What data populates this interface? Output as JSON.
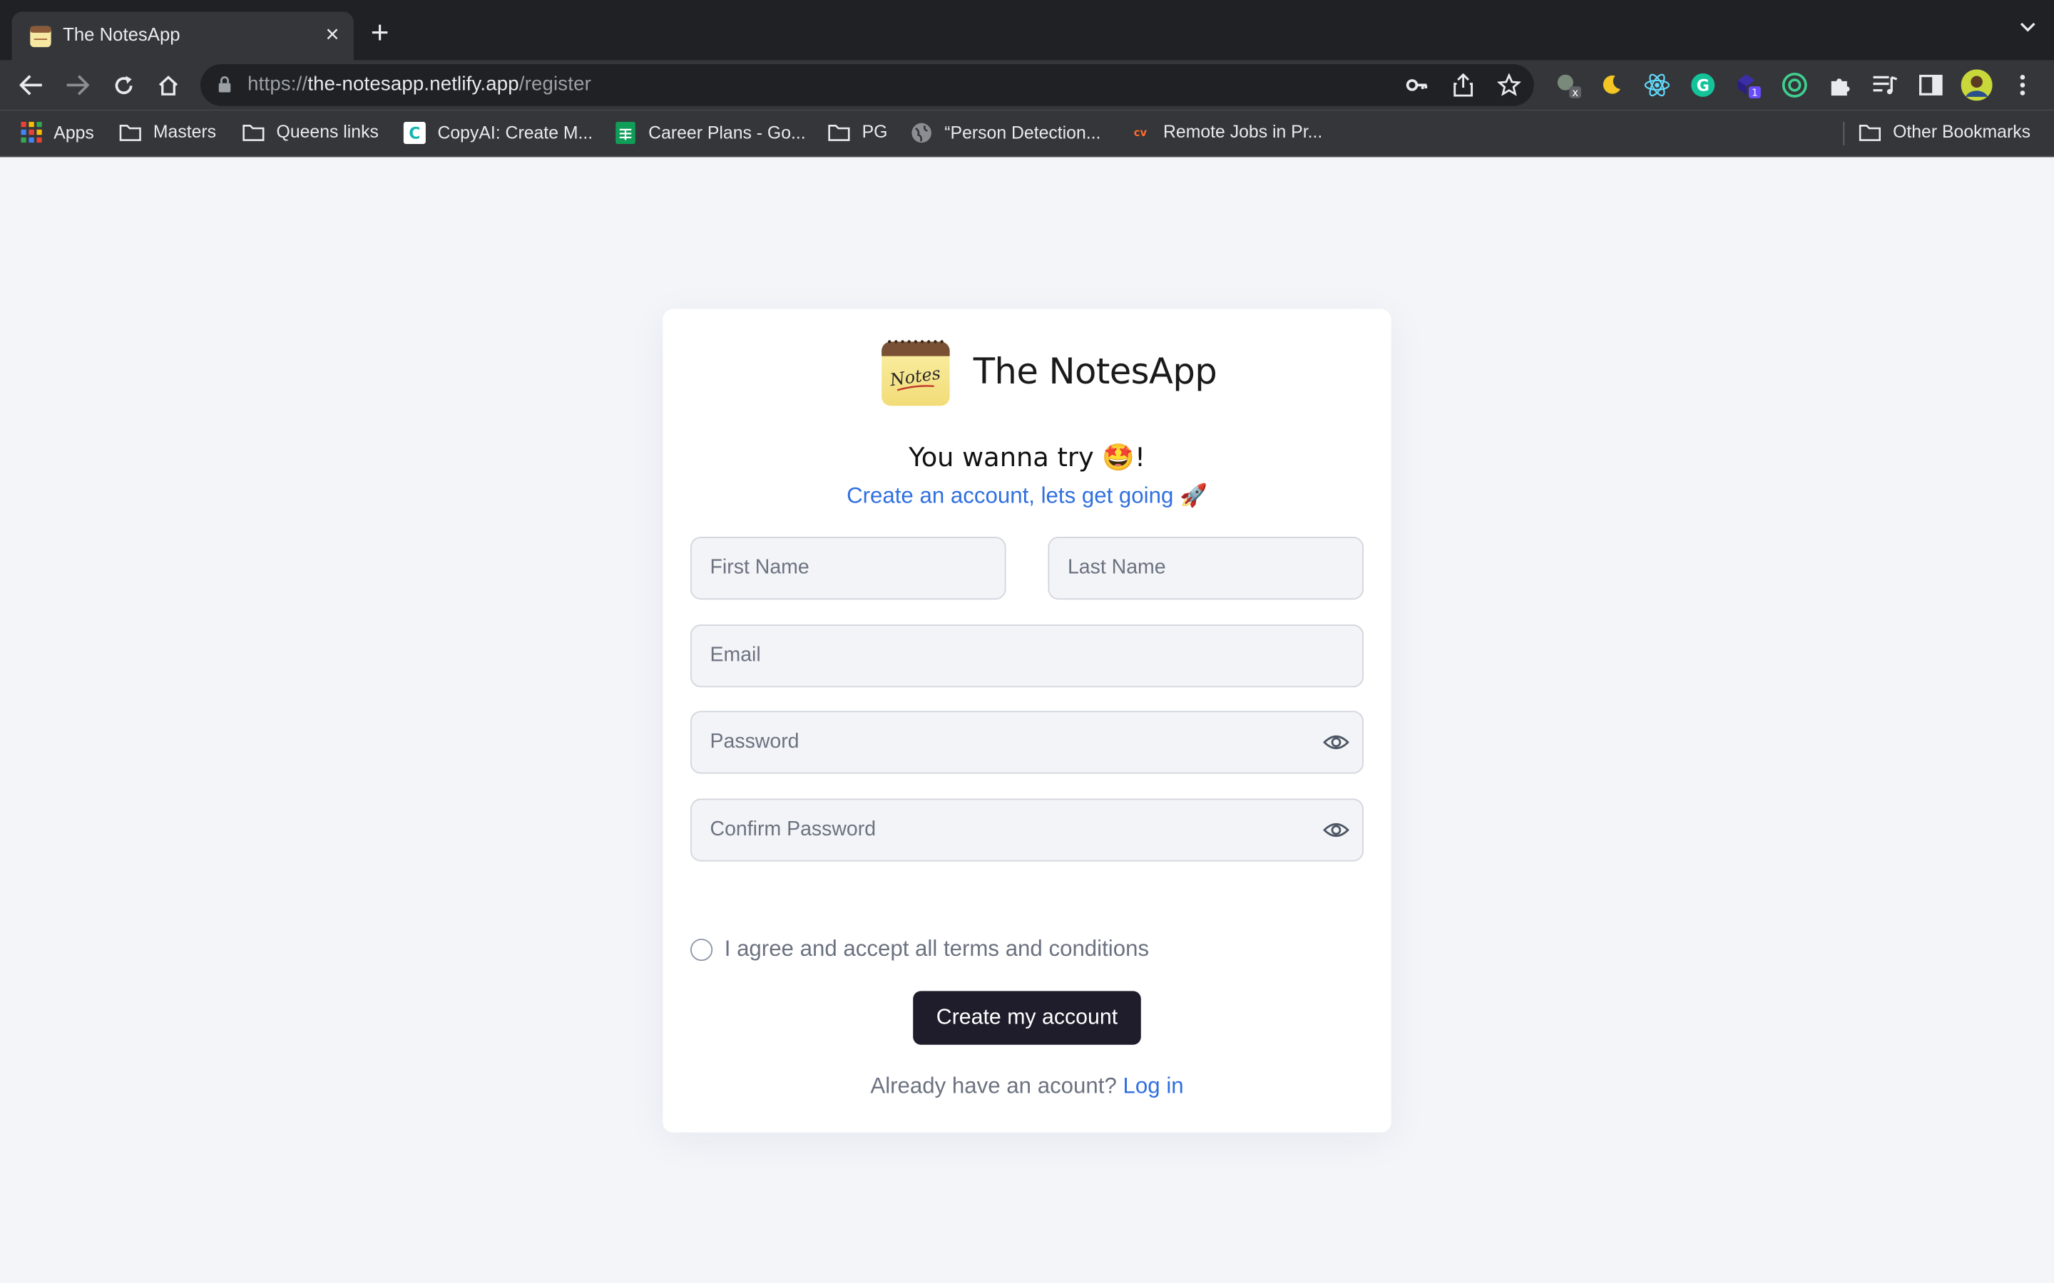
{
  "browser": {
    "tab_title": "The NotesApp",
    "tab_close": "×",
    "new_tab": "+",
    "url_scheme": "https://",
    "url_host": "the-notesapp.netlify.app",
    "url_path": "/register",
    "extension_badge": "1",
    "bookmarks": [
      {
        "label": "Apps",
        "icon": "apps-grid-icon"
      },
      {
        "label": "Masters",
        "icon": "folder-icon"
      },
      {
        "label": "Queens links",
        "icon": "folder-icon"
      },
      {
        "label": "CopyAI: Create M...",
        "icon": "copyai-icon"
      },
      {
        "label": "Career Plans - Go...",
        "icon": "sheets-icon"
      },
      {
        "label": "PG",
        "icon": "folder-icon"
      },
      {
        "label": "“Person Detection...",
        "icon": "globe-icon"
      },
      {
        "label": "Remote Jobs in Pr...",
        "icon": "cv-icon"
      }
    ],
    "other_bookmarks": "Other Bookmarks"
  },
  "form": {
    "app_name": "The NotesApp",
    "headline": "You wanna try 🤩!",
    "subline": "Create an account, lets get going 🚀",
    "first_name_placeholder": "First Name",
    "last_name_placeholder": "Last Name",
    "email_placeholder": "Email",
    "password_placeholder": "Password",
    "confirm_password_placeholder": "Confirm Password",
    "terms_label": "I agree and accept all terms and conditions",
    "submit_label": "Create my account",
    "login_prompt": "Already have an acount?",
    "login_link": "Log in"
  },
  "colors": {
    "accent": "#2f6fe0",
    "button": "#1f1d2b",
    "page_bg": "#f4f5f9"
  }
}
